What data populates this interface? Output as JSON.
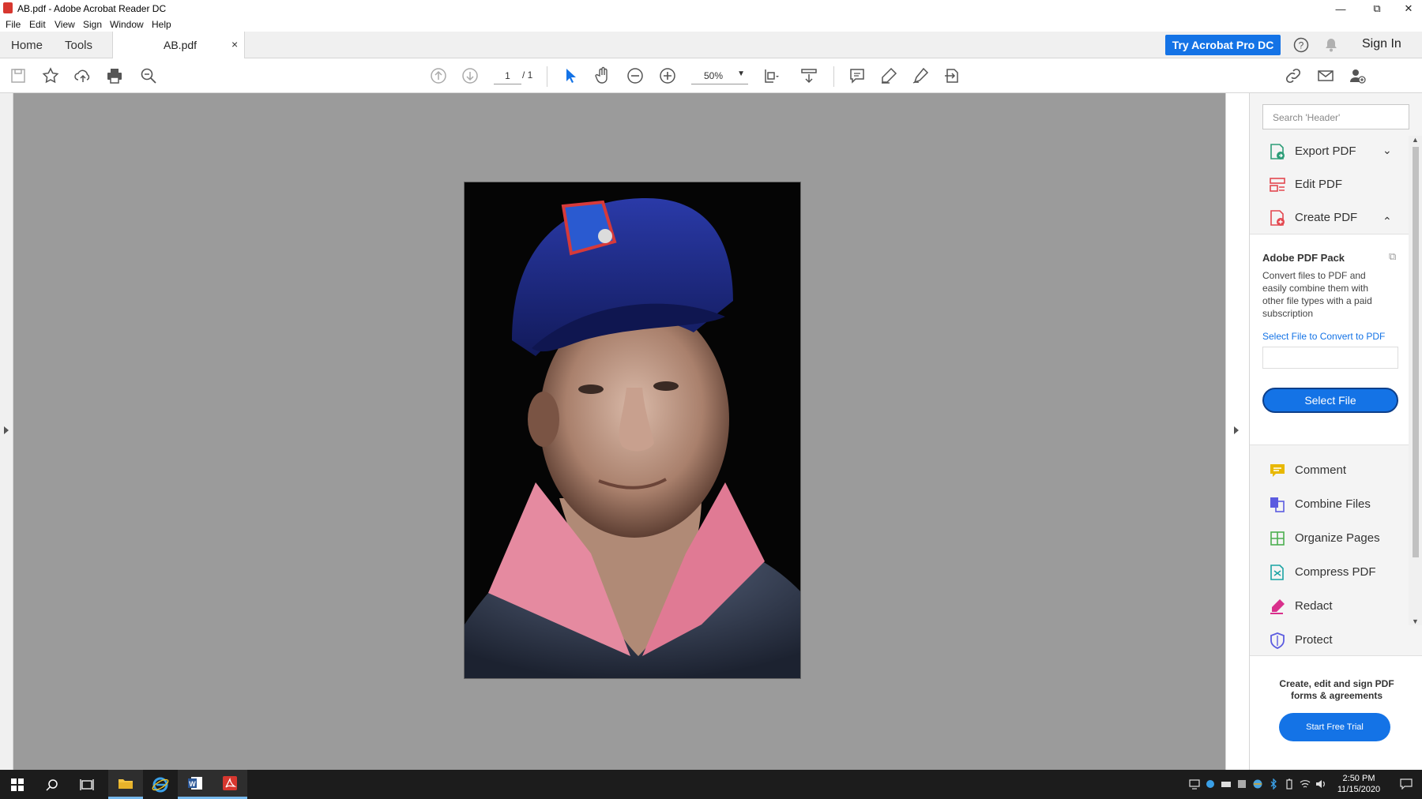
{
  "window": {
    "title": "AB.pdf - Adobe Acrobat Reader DC"
  },
  "menu": [
    "File",
    "Edit",
    "View",
    "Sign",
    "Window",
    "Help"
  ],
  "tabs": {
    "home": "Home",
    "tools": "Tools",
    "document": "AB.pdf",
    "close_glyph": "×"
  },
  "header": {
    "try_pro": "Try Acrobat Pro DC",
    "sign_in": "Sign In"
  },
  "toolbar": {
    "page_current": "1",
    "page_total": "/ 1",
    "zoom": "50%"
  },
  "panel": {
    "search_placeholder": "Search 'Header'",
    "tools": [
      {
        "label": "Export PDF",
        "icon": "export-pdf-icon",
        "color": "#2d9d78"
      },
      {
        "label": "Edit PDF",
        "icon": "edit-pdf-icon",
        "color": "#e34850"
      },
      {
        "label": "Create PDF",
        "icon": "create-pdf-icon",
        "color": "#e34850"
      }
    ],
    "pack": {
      "title": "Adobe PDF Pack",
      "description": "Convert files to PDF and easily combine them with other file types with a paid subscription",
      "select_label": "Select File to Convert to PDF",
      "button": "Select File"
    },
    "more_tools": [
      {
        "label": "Comment",
        "icon": "comment-icon",
        "color": "#e8b800"
      },
      {
        "label": "Combine Files",
        "icon": "combine-files-icon",
        "color": "#5c5ce0"
      },
      {
        "label": "Organize Pages",
        "icon": "organize-pages-icon",
        "color": "#4caf50"
      },
      {
        "label": "Compress PDF",
        "icon": "compress-pdf-icon",
        "color": "#1aa3a3"
      },
      {
        "label": "Redact",
        "icon": "redact-icon",
        "color": "#d9308c"
      },
      {
        "label": "Protect",
        "icon": "protect-icon",
        "color": "#5c5ce0"
      }
    ],
    "promo": {
      "text": "Create, edit and sign PDF forms & agreements",
      "button": "Start Free Trial"
    }
  },
  "taskbar": {
    "time": "2:50 PM",
    "date": "11/15/2020"
  },
  "colors": {
    "accent": "#1473e6",
    "doc_bg": "#9b9b9b",
    "taskbar": "#1c1c1c"
  }
}
